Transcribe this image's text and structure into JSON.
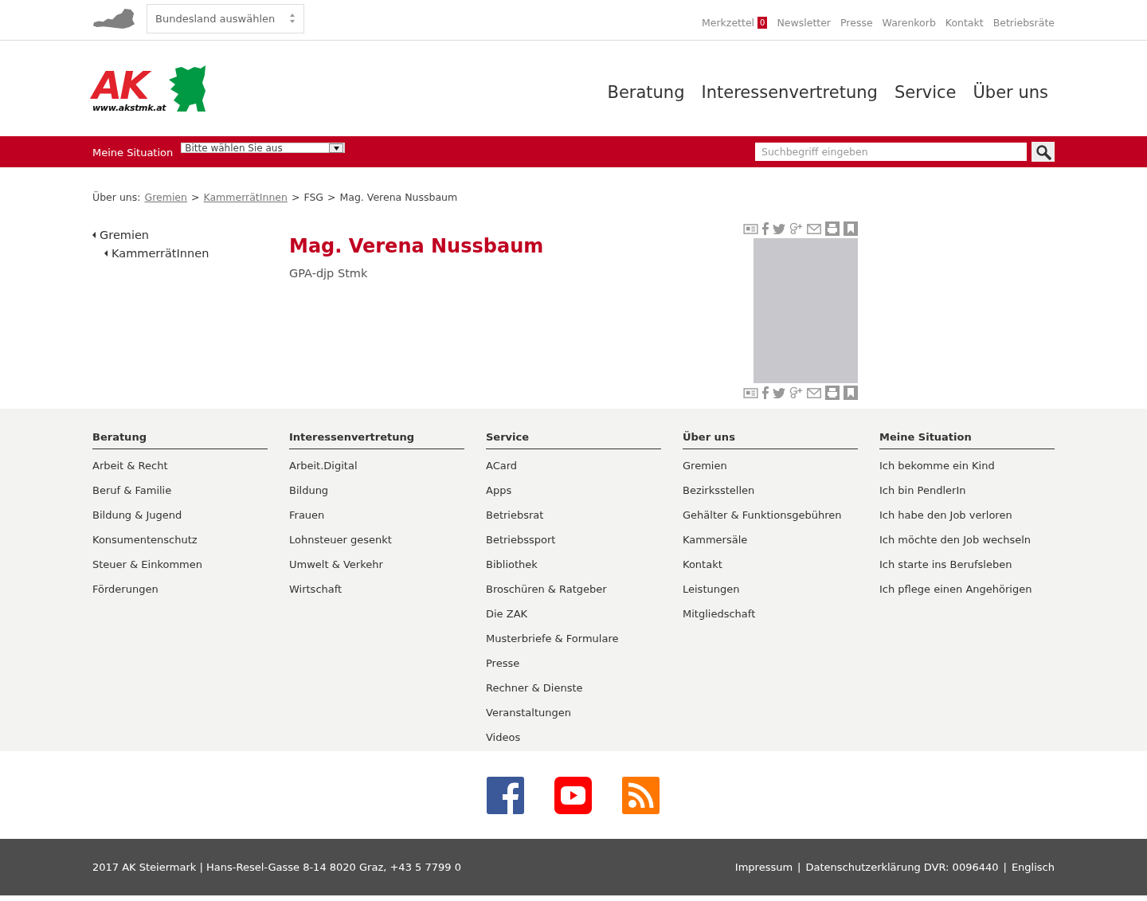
{
  "topbar": {
    "state_select": "Bundesland auswählen",
    "links": [
      {
        "label": "Merkzettel",
        "badge": "0"
      },
      {
        "label": "Newsletter"
      },
      {
        "label": "Presse"
      },
      {
        "label": "Warenkorb"
      },
      {
        "label": "Kontakt"
      },
      {
        "label": "Betriebsräte"
      }
    ]
  },
  "logo": {
    "letters": "AK",
    "url": "www.akstmk.at"
  },
  "main_nav": [
    "Beratung",
    "Interessenvertretung",
    "Service",
    "Über uns"
  ],
  "situation_bar": {
    "label": "Meine Situation",
    "select": "Bitte wählen Sie aus",
    "search_placeholder": "Suchbegriff eingeben"
  },
  "breadcrumb": {
    "label": "Über uns:",
    "separator": ">",
    "items": [
      {
        "text": "Gremien",
        "kind": "link"
      },
      {
        "text": "KammerrätInnen",
        "kind": "link"
      },
      {
        "text": "FSG",
        "kind": "text"
      },
      {
        "text": "Mag. Verena Nussbaum",
        "kind": "text"
      }
    ]
  },
  "side_nav": [
    {
      "label": "Gremien",
      "children": [
        {
          "label": "KammerrätInnen"
        }
      ]
    }
  ],
  "person": {
    "name": "Mag. Verena Nussbaum",
    "organisation": "GPA-djp Stmk"
  },
  "footer_columns": [
    {
      "title": "Beratung",
      "links": [
        "Arbeit & Recht",
        "Beruf & Familie",
        "Bildung & Jugend",
        "Konsumentenschutz",
        "Steuer & Einkommen",
        "Förderungen"
      ]
    },
    {
      "title": "Interessenvertretung",
      "links": [
        "Arbeit.Digital",
        "Bildung",
        "Frauen",
        "Lohnsteuer gesenkt",
        "Umwelt & Verkehr",
        "Wirtschaft"
      ]
    },
    {
      "title": "Service",
      "links": [
        "ACard",
        "Apps",
        "Betriebsrat",
        "Betriebssport",
        "Bibliothek",
        "Broschüren & Ratgeber",
        "Die ZAK",
        "Musterbriefe & Formulare",
        "Presse",
        "Rechner & Dienste",
        "Veranstaltungen",
        "Videos"
      ]
    },
    {
      "title": "Über uns",
      "links": [
        "Gremien",
        "Bezirksstellen",
        "Gehälter & Funktionsgebühren",
        "Kammersäle",
        "Kontakt",
        "Leistungen",
        "Mitgliedschaft"
      ]
    },
    {
      "title": "Meine Situation",
      "links": [
        "Ich bekomme ein Kind",
        "Ich bin PendlerIn",
        "Ich habe den Job verloren",
        "Ich möchte den Job wechseln",
        "Ich starte ins Berufsleben",
        "Ich pflege einen Angehörigen"
      ]
    }
  ],
  "social": [
    {
      "kind": "facebook"
    },
    {
      "kind": "youtube"
    },
    {
      "kind": "rss"
    }
  ],
  "bottom_bar": {
    "address": "2017 AK Steiermark | Hans-Resel-Gasse 8-14 8020 Graz, +43 5 7799 0",
    "separator": "|",
    "links": [
      "Impressum",
      "Datenschutzerklärung DVR: 0096440",
      "Englisch"
    ]
  }
}
